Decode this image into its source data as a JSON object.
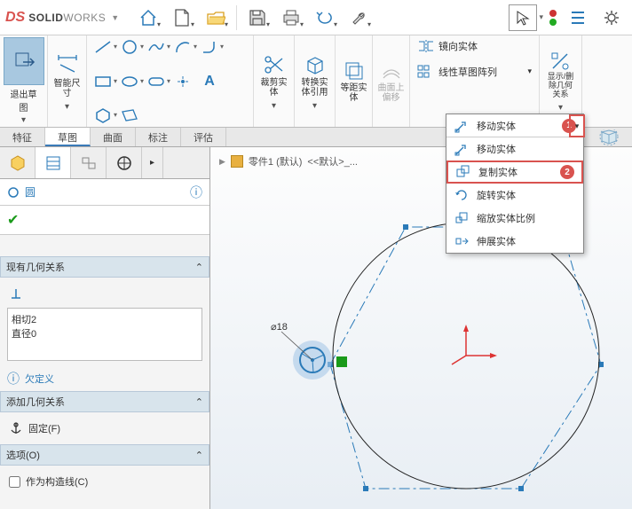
{
  "app": {
    "logo_ds": "DS",
    "logo_solid": "SOLID",
    "logo_works": "WORKS"
  },
  "ribbon": {
    "exit_sketch": "退出草\n图",
    "smart_dim": "智能尺\n寸",
    "trim": "裁剪实\n体",
    "convert": "转换实\n体引用",
    "offset": "等距实\n体",
    "surface_offset": "曲面上\n偏移",
    "mirror": "镜向实体",
    "pattern": "线性草图阵列",
    "show_rel": "显示/删\n除几何\n关系"
  },
  "tabs": {
    "t1": "特征",
    "t2": "草图",
    "t3": "曲面",
    "t4": "标注",
    "t5": "评估"
  },
  "breadcrumb": {
    "part": "零件1 (默认)",
    "config": "<<默认>_..."
  },
  "left": {
    "circle": "圆",
    "sec_existing": "现有几何关系",
    "rel1": "相切2",
    "rel2": "直径0",
    "underdefined": "欠定义",
    "sec_add": "添加几何关系",
    "fix": "固定(F)",
    "sec_options": "选项(O)",
    "construction": "作为构造线(C)"
  },
  "flyout": {
    "header": "移动实体",
    "i1": "移动实体",
    "i2": "复制实体",
    "i3": "旋转实体",
    "i4": "缩放实体比例",
    "i5": "伸展实体"
  },
  "canvas": {
    "dim_label": "⌀18"
  },
  "badges": {
    "b1": "1",
    "b2": "2"
  }
}
